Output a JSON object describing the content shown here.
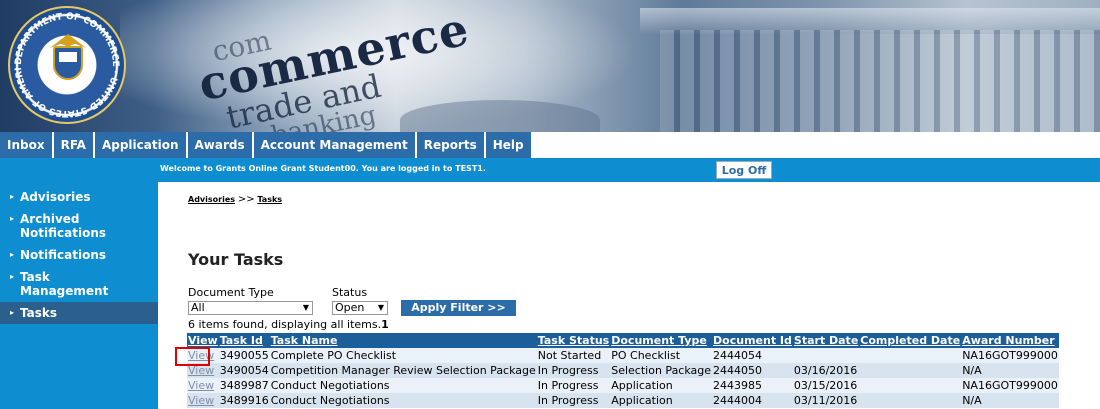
{
  "banner": {
    "seal_text": "DEPARTMENT OF COMMERCE · UNITED STATES OF AMERICA",
    "words": [
      "com",
      "commerce",
      "trade and",
      "banking"
    ]
  },
  "nav": {
    "tabs": [
      "Inbox",
      "RFA",
      "Application",
      "Awards",
      "Account Management",
      "Reports",
      "Help"
    ]
  },
  "header": {
    "welcome": "Welcome to Grants Online Grant Student00. You are logged in to TEST1.",
    "logoff_label": "Log Off"
  },
  "sidebar": {
    "items": [
      {
        "label": "Advisories"
      },
      {
        "label": "Archived Notifications"
      },
      {
        "label": "Notifications"
      },
      {
        "label": "Task Management"
      },
      {
        "label": "Tasks"
      }
    ]
  },
  "breadcrumb": {
    "root": "Advisories",
    "separator": ">>",
    "current": "Tasks"
  },
  "page": {
    "title": "Your Tasks"
  },
  "filters": {
    "doc_type_label": "Document Type",
    "doc_type_value": "All",
    "status_label": "Status",
    "status_value": "Open",
    "apply_label": "Apply Filter >>"
  },
  "results": {
    "summary_prefix": "6 items found, displaying all items.",
    "page": "1"
  },
  "table": {
    "headers": [
      "View",
      "Task Id",
      "Task Name",
      "Task Status",
      "Document Type",
      "Document Id",
      "Start Date",
      "Completed Date",
      "Award Number"
    ],
    "rows": [
      [
        "View",
        "3490055",
        "Complete PO Checklist",
        "Not Started",
        "PO Checklist",
        "2444054",
        "",
        "",
        "NA16GOT999000"
      ],
      [
        "View",
        "3490054",
        "Competition Manager Review Selection Package",
        "In Progress",
        "Selection Package",
        "2444050",
        "03/16/2016",
        "",
        "N/A"
      ],
      [
        "View",
        "3489987",
        "Conduct Negotiations",
        "In Progress",
        "Application",
        "2443985",
        "03/15/2016",
        "",
        "NA16GOT999000"
      ],
      [
        "View",
        "3489916",
        "Conduct Negotiations",
        "In Progress",
        "Application",
        "2444004",
        "03/11/2016",
        "",
        "N/A"
      ]
    ]
  },
  "colors": {
    "nav_tab": "#2c6ca8",
    "header_bar": "#0f8dd1",
    "table_header": "#1b5e9a",
    "highlight_box": "#e00000"
  }
}
